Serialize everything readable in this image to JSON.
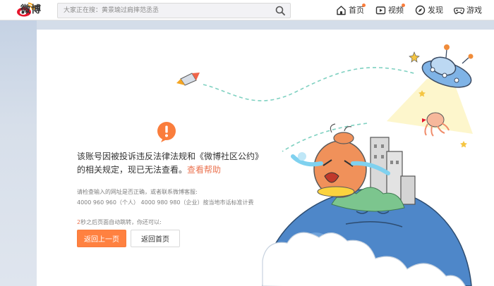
{
  "header": {
    "logo_text": "微博",
    "search": {
      "placeholder": "大家正在搜：黄景瑜过肩摔范丞丞"
    },
    "nav": [
      {
        "label": "首页",
        "icon": "home-icon",
        "has_dot": true
      },
      {
        "label": "视频",
        "icon": "video-icon",
        "has_dot": true
      },
      {
        "label": "发现",
        "icon": "discover-icon",
        "has_dot": false
      },
      {
        "label": "游戏",
        "icon": "game-icon",
        "has_dot": false
      }
    ]
  },
  "error": {
    "icon": "warning-icon",
    "message_line1": "该账号因被投诉违反法律法规和《微博社区公约》",
    "message_line2": "的相关规定，现已无法查看。",
    "help_link": "查看帮助",
    "check_line1": "请检查输入的网址是否正确，或者联系微博客服:",
    "check_line2": "4000 960 960（个人） 4000 980 980（企业）按当地市话标准计费",
    "redirect_seconds": "2",
    "redirect_text": "秒之后页面自动跳转，你还可以:",
    "back_button": "返回上一页",
    "home_button": "返回首页"
  },
  "colors": {
    "accent": "#ff8140",
    "link": "#eb7350",
    "page_bg": "#d4dde9"
  }
}
